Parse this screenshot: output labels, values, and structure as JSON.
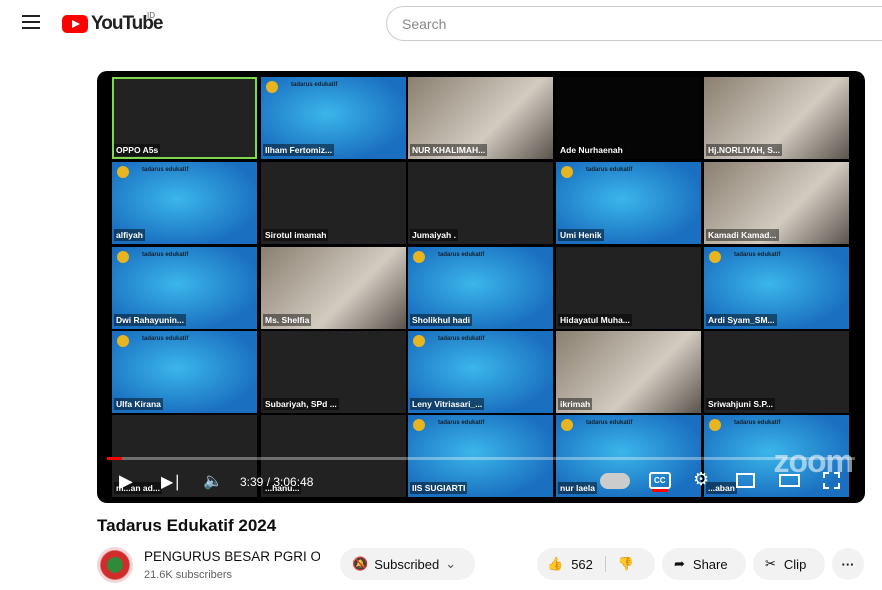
{
  "header": {
    "logo_text": "YouTube",
    "region": "ID",
    "search_placeholder": "Search"
  },
  "video": {
    "tiles": [
      {
        "name": "OPPO A5s",
        "kind": "dark",
        "active": true
      },
      {
        "name": "Ilham Fertomiz...",
        "kind": "slide"
      },
      {
        "name": "NUR KHALIMAH...",
        "kind": "camera"
      },
      {
        "name": "Ade Nurhaenah",
        "kind": "black"
      },
      {
        "name": "Hj.NORLIYAH, S...",
        "kind": "camera"
      },
      {
        "name": "alfiyah",
        "kind": "slide"
      },
      {
        "name": "Sirotul imamah",
        "kind": "dark"
      },
      {
        "name": "Jumaiyah .",
        "kind": "dark"
      },
      {
        "name": "Umi Henik",
        "kind": "slide"
      },
      {
        "name": "Kamadi Kamad...",
        "kind": "camera"
      },
      {
        "name": "Dwi Rahayunin...",
        "kind": "slide"
      },
      {
        "name": "Ms. Shelfia",
        "kind": "camera"
      },
      {
        "name": "Sholikhul hadi",
        "kind": "slide"
      },
      {
        "name": "Hidayatul Muha...",
        "kind": "dark"
      },
      {
        "name": "Ardi Syam_SM...",
        "kind": "slide"
      },
      {
        "name": "Ulfa Kirana",
        "kind": "slide"
      },
      {
        "name": "Subariyah, SPd ...",
        "kind": "dark"
      },
      {
        "name": "Leny Vitriasari_...",
        "kind": "slide"
      },
      {
        "name": "ikrimah",
        "kind": "camera"
      },
      {
        "name": "Sriwahjuni S.P...",
        "kind": "dark"
      },
      {
        "name": "m...an ad...",
        "kind": "dark"
      },
      {
        "name": "...hanu...",
        "kind": "dark"
      },
      {
        "name": "IIS SUGIARTI",
        "kind": "slide"
      },
      {
        "name": "nur laela",
        "kind": "slide"
      },
      {
        "name": "...aban",
        "kind": "slide"
      }
    ],
    "slide_title": "tadarus edukatif",
    "watermark": "zoom",
    "current_time": "3:39",
    "duration": "3:06:48",
    "time_display": "3:39 / 3:06:48",
    "progress_percent": 1.95,
    "cc_label": "CC"
  },
  "info": {
    "title": "Tadarus Edukatif 2024",
    "channel": "PENGURUS BESAR PGRI OFFICIAL",
    "subscribers": "21.6K subscribers",
    "subscribed_label": "Subscribed",
    "likes": "562",
    "share_label": "Share",
    "clip_label": "Clip"
  }
}
